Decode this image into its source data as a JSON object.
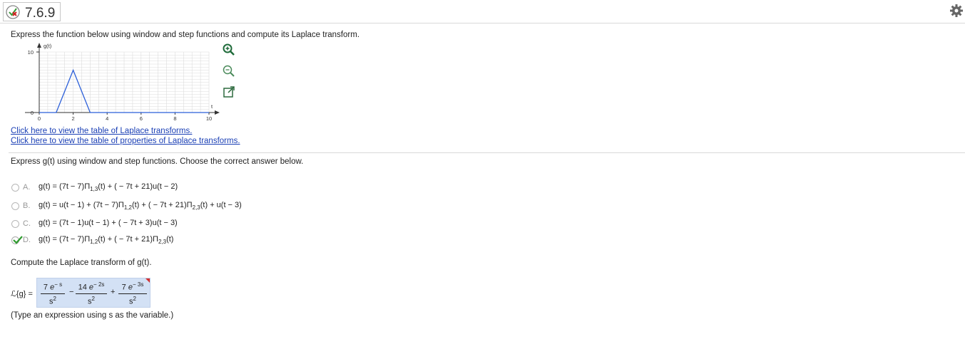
{
  "header": {
    "title": "7.6.9",
    "status_icon": "partial-correct-icon",
    "settings_icon": "gear-icon"
  },
  "question": {
    "prompt": "Express the function below using window and step functions and compute its Laplace transform.",
    "graph": {
      "y_axis_label": "g(t)",
      "x_axis_label": "t",
      "y_ticks": [
        "10",
        "0"
      ],
      "x_ticks": [
        "0",
        "2",
        "4",
        "6",
        "8",
        "10"
      ],
      "curve_points": [
        [
          0,
          0
        ],
        [
          1,
          0
        ],
        [
          2,
          7
        ],
        [
          3,
          0
        ],
        [
          10,
          0
        ]
      ],
      "xlim": [
        0,
        10
      ],
      "ylim": [
        0,
        10
      ]
    },
    "graph_tools": [
      "zoom-in-icon",
      "zoom-out-icon",
      "popout-icon"
    ],
    "links": [
      "Click here to view the table of Laplace transforms.",
      "Click here to view the table of properties of Laplace transforms."
    ]
  },
  "part1": {
    "prompt": "Express g(t) using window and step functions. Choose the correct answer below.",
    "options": [
      {
        "letter": "A.",
        "pre": "g(t) = (7t − 7)Π",
        "sub1": "1,3",
        "mid": "(t) + ( − 7t + 21)u(t − 2)",
        "sub2": "",
        "post": "",
        "selected": false
      },
      {
        "letter": "B.",
        "pre": "g(t) = u(t − 1) + (7t − 7)Π",
        "sub1": "1,2",
        "mid": "(t) + ( − 7t + 21)Π",
        "sub2": "2,3",
        "post": "(t) + u(t − 3)",
        "selected": false
      },
      {
        "letter": "C.",
        "pre": "g(t) = (7t − 1)u(t − 1) + ( − 7t + 3)u(t − 3)",
        "sub1": "",
        "mid": "",
        "sub2": "",
        "post": "",
        "selected": false
      },
      {
        "letter": "D.",
        "pre": "g(t) = (7t − 7)Π",
        "sub1": "1,2",
        "mid": "(t) + ( − 7t + 21)Π",
        "sub2": "2,3",
        "post": "(t)",
        "selected": true
      }
    ]
  },
  "part2": {
    "prompt": "Compute the Laplace transform of g(t).",
    "lhs": "ℒ{g} =",
    "terms": [
      {
        "coef": "7",
        "var": "e",
        "exp": "− s",
        "den": "s",
        "den_exp": "2"
      },
      {
        "coef": "14",
        "var": "e",
        "exp": "− 2s",
        "den": "s",
        "den_exp": "2"
      },
      {
        "coef": "7",
        "var": "e",
        "exp": "− 3s",
        "den": "s",
        "den_exp": "2"
      }
    ],
    "ops": [
      "−",
      "+"
    ],
    "hint": "(Type an expression using s as the variable.)"
  }
}
